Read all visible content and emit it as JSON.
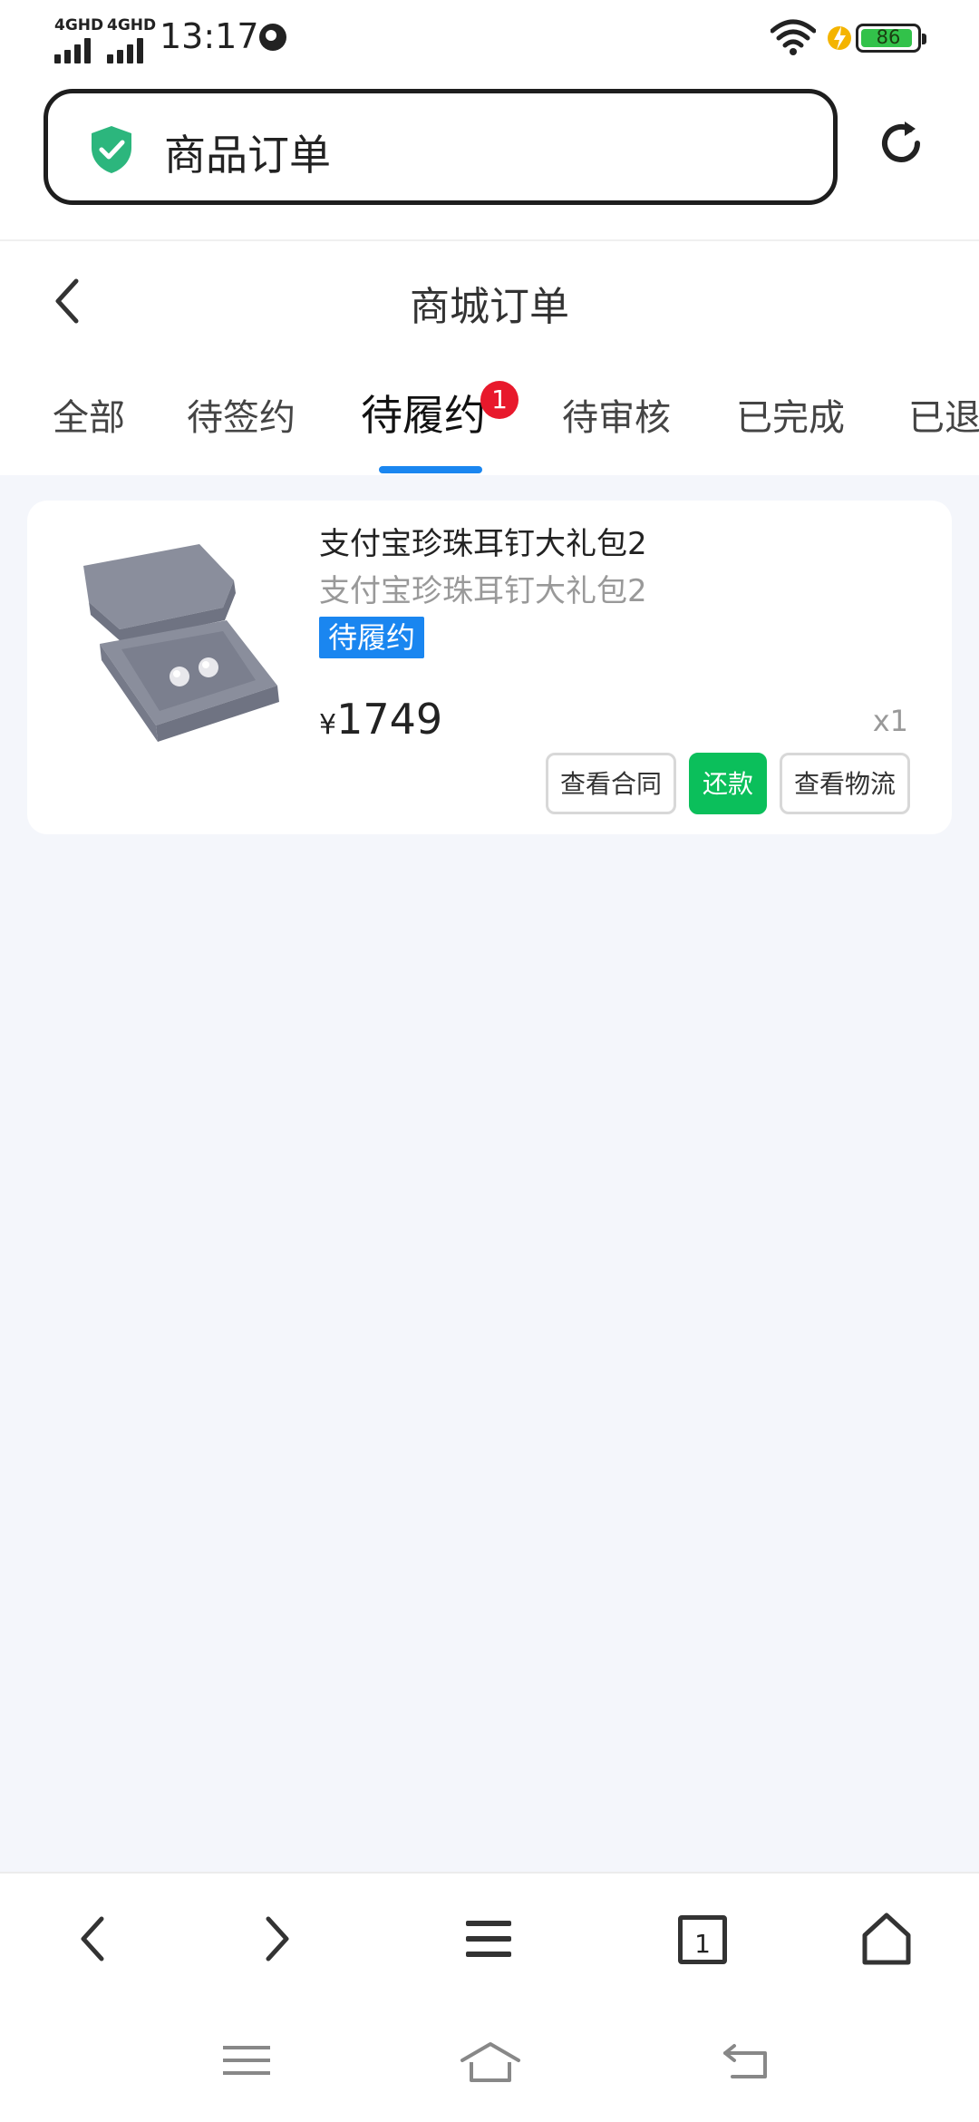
{
  "status_bar": {
    "network_1": "4GHD",
    "network_2": "4GHD",
    "time": "13:17",
    "battery_level": "86"
  },
  "browser": {
    "url_text": "商品订单",
    "tab_count": "1"
  },
  "header": {
    "title": "商城订单"
  },
  "tabs": [
    {
      "label": "全部"
    },
    {
      "label": "待签约"
    },
    {
      "label": "待履约",
      "badge": "1",
      "active": true
    },
    {
      "label": "待审核"
    },
    {
      "label": "已完成"
    },
    {
      "label": "已退"
    }
  ],
  "order": {
    "title": "支付宝珍珠耳钉大礼包2",
    "subtitle": "支付宝珍珠耳钉大礼包2",
    "status": "待履约",
    "currency": "¥",
    "price": "1749",
    "quantity": "x1",
    "buttons": {
      "contract": "查看合同",
      "pay": "还款",
      "logistics": "查看物流"
    }
  },
  "colors": {
    "accent_blue": "#1a86f0",
    "pay_green": "#0bbf5b",
    "badge_red": "#e8192c",
    "page_bg": "#f4f6fb"
  }
}
